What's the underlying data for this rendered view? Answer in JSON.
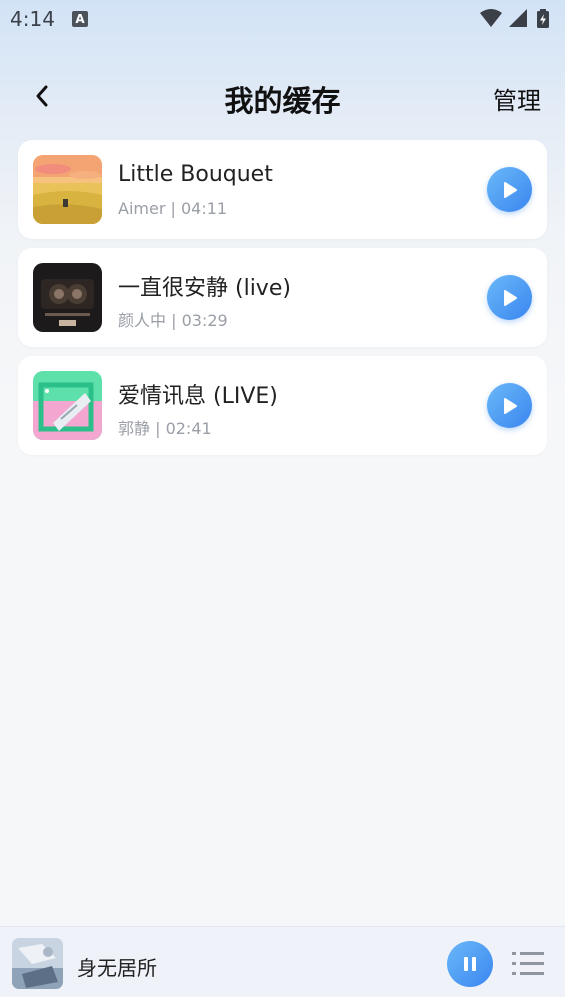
{
  "status_bar": {
    "time": "4:14",
    "notification_icon": "A",
    "icons": [
      "wifi-icon",
      "signal-icon",
      "battery-charging-icon"
    ]
  },
  "header": {
    "title": "我的缓存",
    "manage_label": "管理",
    "back_icon": "chevron-left-icon"
  },
  "songs": [
    {
      "title": "Little Bouquet",
      "meta": "Aimer | 04:11"
    },
    {
      "title": "一直很安静 (live)",
      "meta": "颜人中 | 03:29"
    },
    {
      "title": "爱情讯息 (LIVE)",
      "meta": "郭静 | 02:41"
    }
  ],
  "mini_player": {
    "title": "身无居所",
    "state": "playing",
    "controls": [
      "pause-icon",
      "playlist-icon"
    ]
  },
  "colors": {
    "accent": "#3a86f0",
    "accent_light": "#6ab8f8",
    "card_bg": "#ffffff",
    "page_bg": "#f6f7f9"
  }
}
